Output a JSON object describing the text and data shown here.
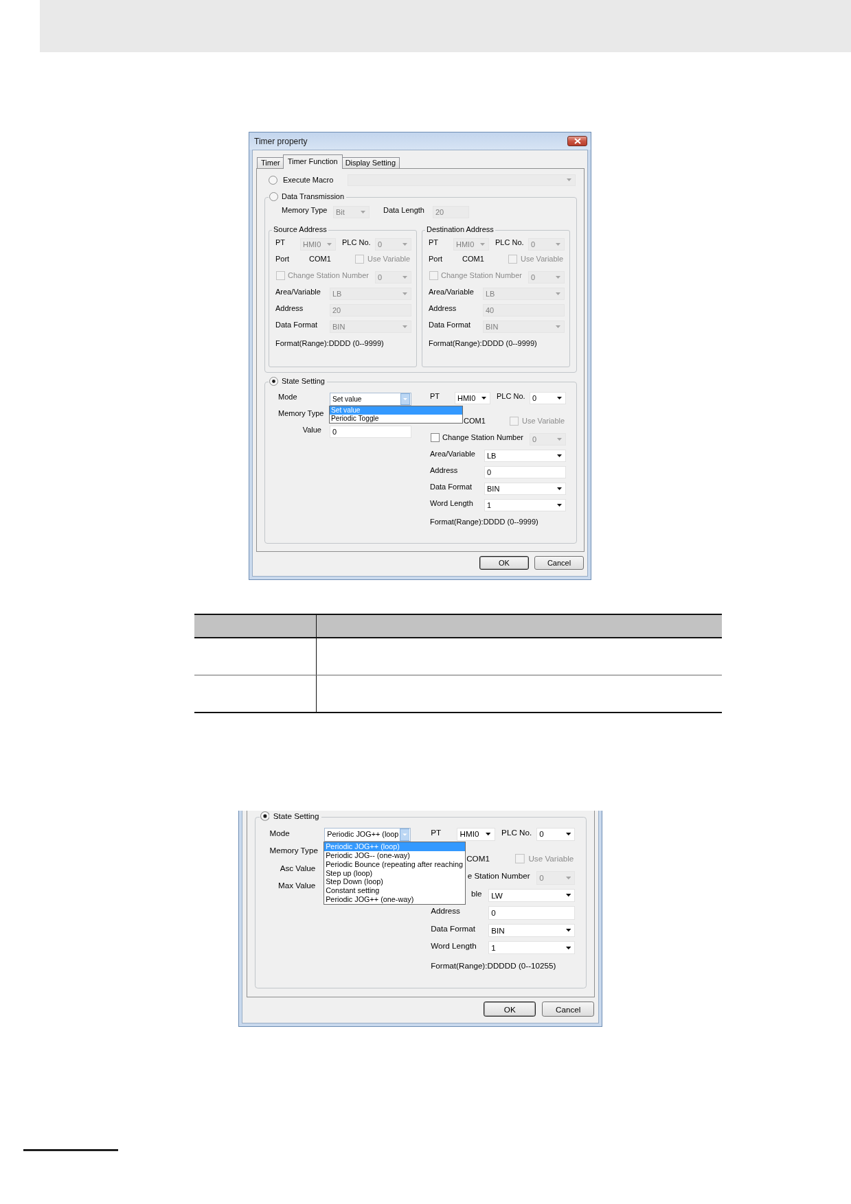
{
  "dialogs": [
    {
      "title": "Timer property",
      "tabs": [
        {
          "label": "Timer",
          "selected": false
        },
        {
          "label": "Timer Function",
          "selected": true
        },
        {
          "label": "Display Setting",
          "selected": false
        }
      ],
      "execute_macro": {
        "label": "Execute Macro",
        "selected": false,
        "disabled": true
      },
      "data_transmission": {
        "label": "Data Transmission",
        "selected": false,
        "memory_type": {
          "label": "Memory Type",
          "value": "Bit",
          "disabled": true
        },
        "data_length": {
          "label": "Data Length",
          "value": "20",
          "disabled": true
        },
        "blocks": [
          {
            "title": "Source Address",
            "pt": {
              "label": "PT",
              "value": "HMI0",
              "disabled": true
            },
            "plc": {
              "label": "PLC No.",
              "value": "0",
              "disabled": true
            },
            "port": {
              "label": "Port",
              "value": "COM1"
            },
            "use_variable": {
              "label": "Use Variable",
              "checked": false,
              "disabled": true
            },
            "change_station": {
              "label": "Change Station Number",
              "checked": false,
              "disabled": true
            },
            "station": {
              "value": "0",
              "disabled": true
            },
            "area": {
              "label": "Area/Variable",
              "value": "LB",
              "disabled": true
            },
            "address": {
              "label": "Address",
              "value": "20",
              "disabled": true
            },
            "data_format": {
              "label": "Data Format",
              "value": "BIN",
              "disabled": true
            },
            "range": "Format(Range):DDDD (0--9999)"
          },
          {
            "title": "Destination Address",
            "pt": {
              "label": "PT",
              "value": "HMI0",
              "disabled": true
            },
            "plc": {
              "label": "PLC No.",
              "value": "0",
              "disabled": true
            },
            "port": {
              "label": "Port",
              "value": "COM1"
            },
            "use_variable": {
              "label": "Use Variable",
              "checked": false,
              "disabled": true
            },
            "change_station": {
              "label": "Change Station Number",
              "checked": false,
              "disabled": true
            },
            "station": {
              "value": "0",
              "disabled": true
            },
            "area": {
              "label": "Area/Variable",
              "value": "LB",
              "disabled": true
            },
            "address": {
              "label": "Address",
              "value": "40",
              "disabled": true
            },
            "data_format": {
              "label": "Data Format",
              "value": "BIN",
              "disabled": true
            },
            "range": "Format(Range):DDDD (0--9999)"
          }
        ]
      },
      "state_setting": {
        "label": "State Setting",
        "selected": true,
        "rows": [
          {
            "label": "Mode",
            "kind": "dropdown",
            "value": "Set value",
            "expanded": true,
            "options": [
              {
                "label": "Set value",
                "selected": true
              },
              {
                "label": "Periodic Toggle",
                "selected": false
              }
            ]
          },
          {
            "label": "Memory Type",
            "kind": "label"
          },
          {
            "label": "Value",
            "kind": "field",
            "right_aligned": true,
            "value": "0",
            "disabled": false
          }
        ],
        "target": {
          "pt": {
            "label": "PT",
            "value": "HMI0",
            "disabled": false
          },
          "plc": {
            "label": "PLC No.",
            "value": "0",
            "disabled": false
          },
          "port": {
            "value": "COM1"
          },
          "use_variable": {
            "label": "Use Variable",
            "checked": false,
            "disabled": true
          },
          "change_station": {
            "label": "Change Station Number",
            "checked": false,
            "disabled": false
          },
          "station": {
            "value": "0",
            "disabled": true
          },
          "area": {
            "label": "Area/Variable",
            "value": "LB",
            "disabled": false
          },
          "address": {
            "label": "Address",
            "value": "0",
            "disabled": false
          },
          "data_format": {
            "label": "Data Format",
            "value": "BIN",
            "disabled": false
          },
          "word_length": {
            "label": "Word Length",
            "value": "1",
            "disabled": false
          },
          "range": "Format(Range):DDDD (0--9999)"
        }
      },
      "buttons": [
        {
          "label": "OK",
          "kind": "ok"
        },
        {
          "label": "Cancel",
          "kind": "cancel"
        }
      ]
    },
    {
      "state_setting": {
        "label": "State Setting",
        "selected": true,
        "rows": [
          {
            "label": "Mode",
            "kind": "dropdown",
            "value": "Periodic JOG++ (loop",
            "expanded": true,
            "options": [
              {
                "label": "Periodic JOG++ (loop)",
                "selected": true
              },
              {
                "label": "Periodic JOG-- (one-way)",
                "selected": false
              },
              {
                "label": "Periodic Bounce (repeating after reaching",
                "selected": false
              },
              {
                "label": "Step up (loop)",
                "selected": false
              },
              {
                "label": "Step Down (loop)",
                "selected": false
              },
              {
                "label": "Constant setting",
                "selected": false
              },
              {
                "label": "Periodic JOG++ (one-way)",
                "selected": false
              }
            ]
          },
          {
            "label": "Memory Type",
            "kind": "label"
          },
          {
            "label": "Asc Value",
            "kind": "label",
            "right_aligned": true
          },
          {
            "label": "Max Value",
            "kind": "label",
            "right_aligned": true
          }
        ],
        "target": {
          "pt": {
            "label": "PT",
            "value": "HMI0",
            "disabled": false
          },
          "plc": {
            "label": "PLC No.",
            "value": "0",
            "disabled": false
          },
          "port": {
            "value": "COM1"
          },
          "use_variable": {
            "label": "Use Variable",
            "checked": false,
            "disabled": true
          },
          "change_station": {
            "label": "e Station Number",
            "cut_start": true,
            "disabled": false
          },
          "station": {
            "value": "0",
            "disabled": true
          },
          "area": {
            "label": "ble",
            "cut_start": true,
            "value": "LW",
            "disabled": false
          },
          "address": {
            "label": "Address",
            "value": "0",
            "disabled": false
          },
          "data_format": {
            "label": "Data Format",
            "value": "BIN",
            "disabled": false
          },
          "word_length": {
            "label": "Word Length",
            "value": "1",
            "disabled": false
          },
          "range": "Format(Range):DDDDD (0--10255)"
        }
      },
      "buttons": [
        {
          "label": "OK",
          "kind": "ok"
        },
        {
          "label": "Cancel",
          "kind": "cancel"
        }
      ]
    }
  ]
}
